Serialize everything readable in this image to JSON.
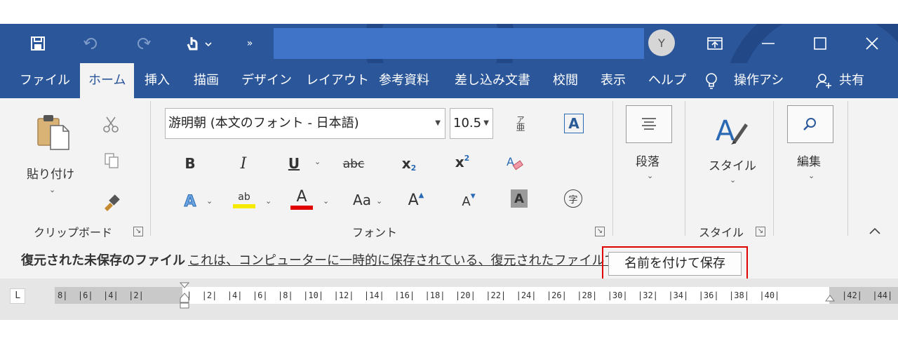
{
  "window": {
    "title_avatar": "Y",
    "colors": {
      "accent": "#2b579a",
      "title_box": "#3f74c9",
      "highlight_frame": "#e00000"
    }
  },
  "quick_access": {
    "icons": [
      "save-icon",
      "undo-icon",
      "redo-icon",
      "touch-mode-icon",
      "more-commands-icon"
    ]
  },
  "window_controls": {
    "icons": [
      "ribbon-display-options-icon",
      "minimize-icon",
      "maximize-icon",
      "close-icon"
    ]
  },
  "tabs": [
    {
      "label": "ファイル"
    },
    {
      "label": "ホーム"
    },
    {
      "label": "挿入"
    },
    {
      "label": "描画"
    },
    {
      "label": "デザイン"
    },
    {
      "label": "レイアウト"
    },
    {
      "label": "参考資料"
    },
    {
      "label": "差し込み文書"
    },
    {
      "label": "校閲"
    },
    {
      "label": "表示"
    },
    {
      "label": "ヘルプ"
    },
    {
      "label": "操作アシ"
    },
    {
      "label": "共有"
    }
  ],
  "ribbon": {
    "clipboard": {
      "paste_label": "貼り付け",
      "group_label": "クリップボード"
    },
    "font": {
      "font_name": "游明朝 (本文のフォント - 日本語)",
      "font_size": "10.5",
      "bold": "B",
      "italic": "I",
      "underline": "U",
      "strikethrough": "abc",
      "subscript": "x",
      "subscript_mark": "2",
      "superscript": "x",
      "superscript_mark": "2",
      "text_effect": "A",
      "highlight": "ab",
      "font_color": "A",
      "change_case": "Aa",
      "grow": "A",
      "shrink": "A",
      "char_shading": "A",
      "enclose": "字",
      "phonetic": "亜",
      "char_border": "A",
      "group_label": "フォント"
    },
    "paragraph": {
      "label": "段落"
    },
    "styles": {
      "label": "スタイル",
      "group_label": "スタイル"
    },
    "editing": {
      "label": "編集"
    }
  },
  "infobar": {
    "title": "復元された未保存のファイル",
    "message": "これは、コンピューターに一時的に保存されている、復元されたファイルです。",
    "save_as_button": "名前を付けて保存"
  },
  "ruler": {
    "tab_selector": "L",
    "left_ticks": "8|  |6|  |4|  |2|",
    "right_ticks": "|  |2|  |4|  |6|  |8|  |10|  |12|  |14|  |16|  |18|  |20|  |22|  |24|  |26|  |28|  |30|  |32|  |34|  |36|  |38|  |40|",
    "far_ticks": "|42|  |44|"
  }
}
